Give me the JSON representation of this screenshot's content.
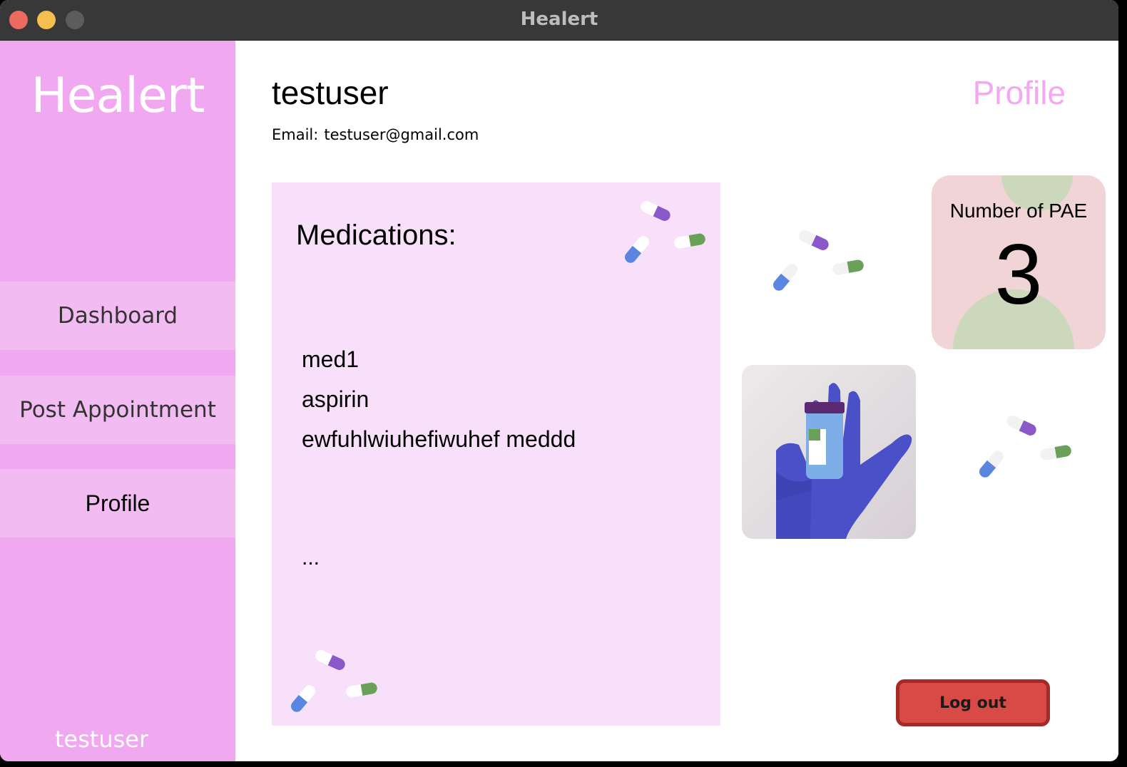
{
  "window": {
    "title": "Healert"
  },
  "sidebar": {
    "logo": "Healert",
    "items": [
      {
        "label": "Dashboard"
      },
      {
        "label": "Post Appointment"
      },
      {
        "label": "Profile",
        "active": true
      }
    ],
    "footer_username": "testuser"
  },
  "main": {
    "page_label": "Profile",
    "username": "testuser",
    "email_label": "Email:",
    "email_value": "testuser@gmail.com",
    "medications": {
      "title": "Medications:",
      "items": [
        "med1",
        "aspirin",
        "ewfuhlwiuhefiwuhef meddd"
      ],
      "more": "..."
    },
    "pae": {
      "label": "Number of PAE",
      "value": "3"
    },
    "logout_label": "Log out"
  },
  "colors": {
    "sidebar": "#f0a8f0",
    "nav_item": "#f2bcf2",
    "card": "#f8e0fb",
    "accent": "#f4a8f0",
    "logout": "#d74a46"
  },
  "icons": [
    "pills-icon",
    "medicine-hand-image"
  ]
}
